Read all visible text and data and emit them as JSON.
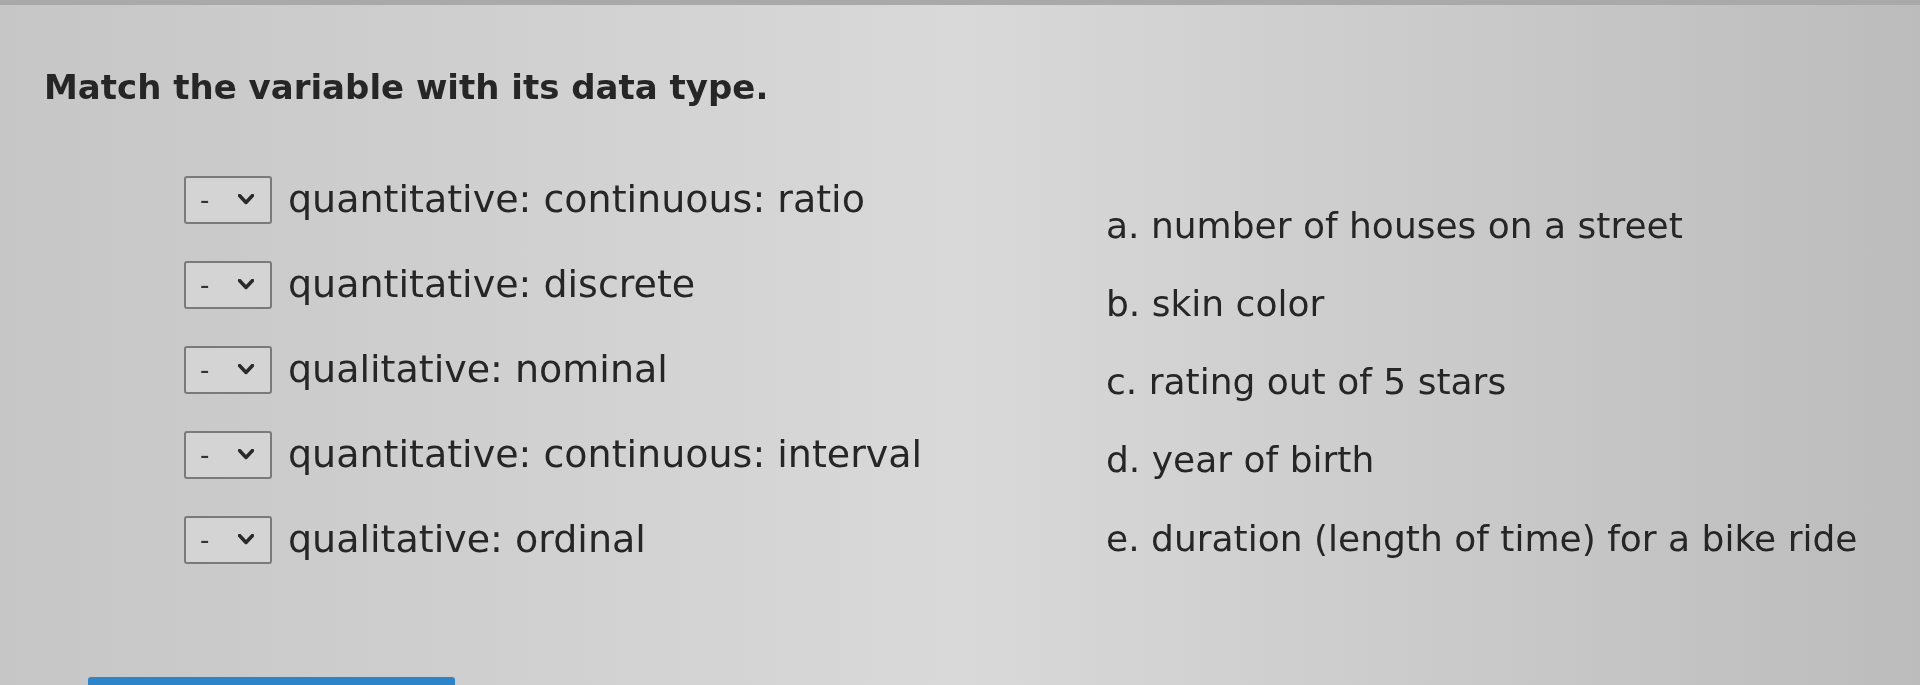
{
  "prompt": "Match the variable with its data type.",
  "matches": [
    {
      "answer": "-",
      "label": "quantitative: continuous: ratio"
    },
    {
      "answer": "-",
      "label": "quantitative: discrete"
    },
    {
      "answer": "-",
      "label": "qualitative: nominal"
    },
    {
      "answer": "-",
      "label": "quantitative: continuous: interval"
    },
    {
      "answer": "-",
      "label": "qualitative: ordinal"
    }
  ],
  "options": [
    "a. number of houses on a street",
    "b. skin color",
    "c. rating out of 5 stars",
    "d. year of birth",
    "e. duration (length of time) for a bike ride"
  ]
}
